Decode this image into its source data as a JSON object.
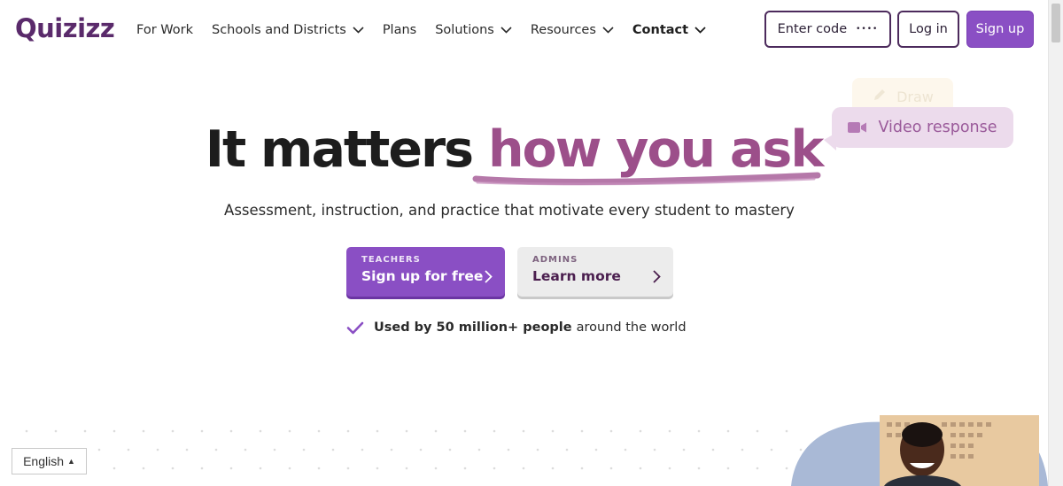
{
  "brand": {
    "logo_text": "Quizizz",
    "color": "#5a2a6b"
  },
  "nav": {
    "items": [
      {
        "label": "For Work",
        "dropdown": false
      },
      {
        "label": "Schools and Districts",
        "dropdown": true
      },
      {
        "label": "Plans",
        "dropdown": false
      },
      {
        "label": "Solutions",
        "dropdown": true
      },
      {
        "label": "Resources",
        "dropdown": true
      },
      {
        "label": "Contact",
        "dropdown": true
      }
    ]
  },
  "header_buttons": {
    "enter_code": "Enter code",
    "enter_code_dots": "••••",
    "login": "Log in",
    "signup": "Sign up"
  },
  "chips": {
    "draw": "Draw",
    "video": "Video response"
  },
  "hero": {
    "headline_plain": "It matters ",
    "headline_accent": "how you ask",
    "subhead": "Assessment, instruction, and practice that motivate every student to mastery"
  },
  "cta": {
    "teachers_eyebrow": "TEACHERS",
    "teachers_label": "Sign up for free",
    "admins_eyebrow": "ADMINS",
    "admins_label": "Learn more"
  },
  "trust": {
    "bold": "Used by 50 million+ people",
    "rest": "around the world"
  },
  "language": {
    "selected": "English"
  },
  "colors": {
    "primary": "#8a4fc4",
    "accent_text": "#9c4f8a",
    "dark_purple": "#4c2a5c",
    "chip_bg": "#ecdbec"
  }
}
